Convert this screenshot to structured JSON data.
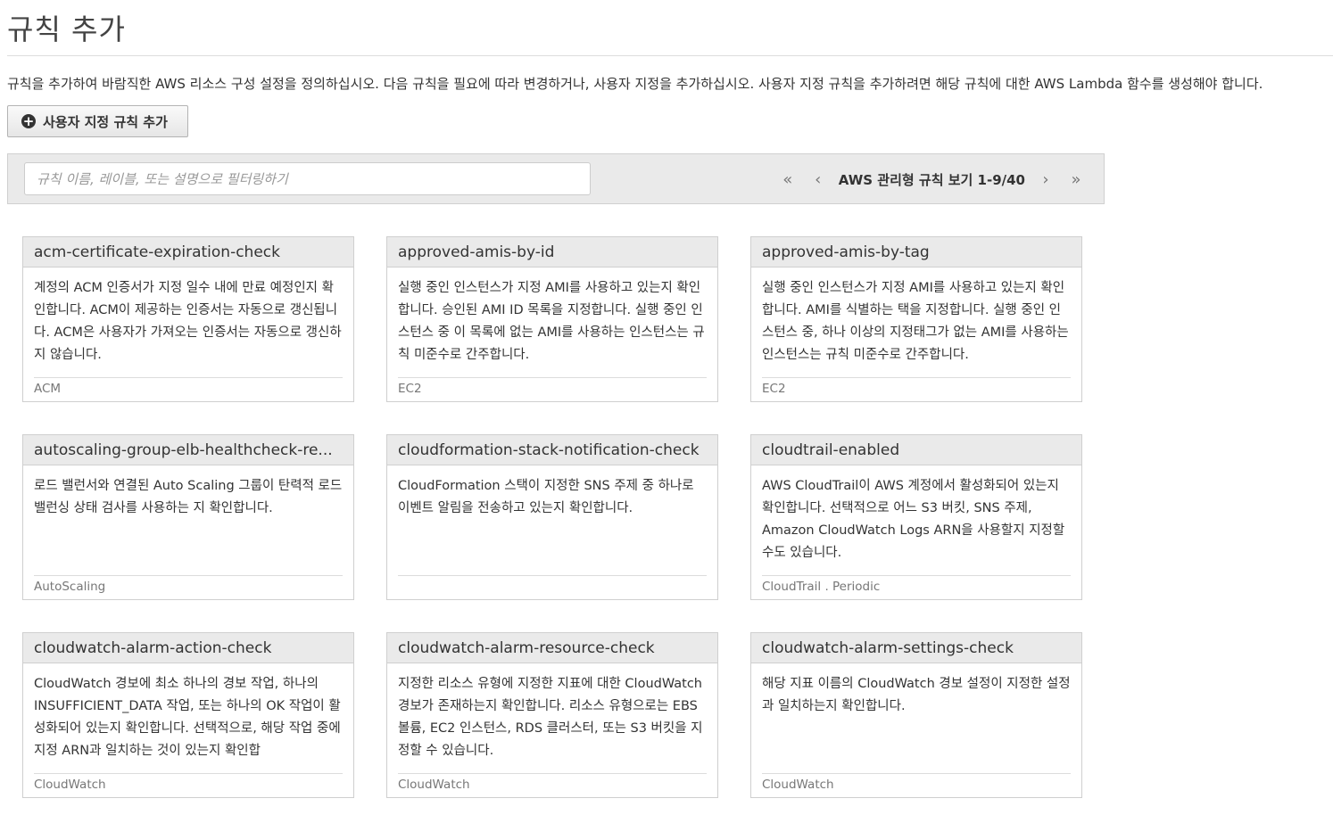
{
  "page": {
    "title": "규칙 추가",
    "intro": "규칙을 추가하여 바람직한 AWS 리소스 구성 설정을 정의하십시오. 다음 규칙을 필요에 따라 변경하거나, 사용자 지정을 추가하십시오. 사용자 지정 규칙을 추가하려면 해당 규칙에 대한 AWS Lambda 함수를 생성해야 합니다."
  },
  "toolbar": {
    "add_custom_rule_label": "사용자 지정 규칙 추가",
    "add_icon": "plus-circle-icon"
  },
  "filter": {
    "placeholder": "규칙 이름, 레이블, 또는 설명으로 필터링하기",
    "value": ""
  },
  "pagination": {
    "first_icon": "«",
    "prev_icon": "‹",
    "label": "AWS 관리형 규칙 보기 1-9/40",
    "next_icon": "›",
    "last_icon": "»"
  },
  "rules": [
    {
      "name": "acm-certificate-expiration-check",
      "description": "계정의 ACM 인증서가 지정 일수 내에 만료 예정인지 확인합니다. ACM이 제공하는 인증서는 자동으로 갱신됩니다. ACM은 사용자가 가져오는 인증서는 자동으로 갱신하지 않습니다.",
      "tags": "ACM"
    },
    {
      "name": "approved-amis-by-id",
      "description": "실행 중인 인스턴스가 지정 AMI를 사용하고 있는지 확인합니다. 승인된 AMI ID 목록을 지정합니다. 실행 중인 인스턴스 중 이 목록에 없는 AMI를 사용하는 인스턴스는 규칙 미준수로 간주합니다.",
      "tags": "EC2"
    },
    {
      "name": "approved-amis-by-tag",
      "description": "실행 중인 인스턴스가 지정 AMI를 사용하고 있는지 확인합니다. AMI를 식별하는 택을 지정합니다. 실행 중인 인스턴스 중, 하나 이상의 지정태그가 없는 AMI를 사용하는 인스턴스는 규칙 미준수로 간주합니다.",
      "tags": "EC2"
    },
    {
      "name": "autoscaling-group-elb-healthcheck-re...",
      "description": "로드 밸런서와 연결된 Auto Scaling 그룹이 탄력적 로드 밸런싱 상태 검사를 사용하는 지 확인합니다.",
      "tags": "AutoScaling"
    },
    {
      "name": "cloudformation-stack-notification-check",
      "description": "CloudFormation 스택이 지정한 SNS 주제 중 하나로 이벤트 알림을 전송하고 있는지 확인합니다.",
      "tags": ""
    },
    {
      "name": "cloudtrail-enabled",
      "description": "AWS CloudTrail이 AWS 계정에서 활성화되어 있는지 확인합니다. 선택적으로 어느 S3 버킷, SNS 주제, Amazon CloudWatch Logs ARN을 사용할지 지정할 수도 있습니다.",
      "tags": "CloudTrail . Periodic"
    },
    {
      "name": "cloudwatch-alarm-action-check",
      "description": "CloudWatch 경보에 최소 하나의 경보 작업, 하나의 INSUFFICIENT_DATA 작업, 또는 하나의 OK 작업이 활성화되어 있는지 확인합니다. 선택적으로, 해당 작업 중에 지정 ARN과 일치하는 것이 있는지 확인합",
      "tags": "CloudWatch"
    },
    {
      "name": "cloudwatch-alarm-resource-check",
      "description": "지정한 리소스 유형에 지정한 지표에 대한 CloudWatch 경보가 존재하는지 확인합니다. 리소스 유형으로는 EBS 볼륨, EC2 인스턴스, RDS 클러스터, 또는 S3 버킷을 지정할 수 있습니다.",
      "tags": "CloudWatch"
    },
    {
      "name": "cloudwatch-alarm-settings-check",
      "description": "해당 지표 이름의 CloudWatch 경보 설정이 지정한 설정과 일치하는지 확인합니다.",
      "tags": "CloudWatch"
    }
  ]
}
